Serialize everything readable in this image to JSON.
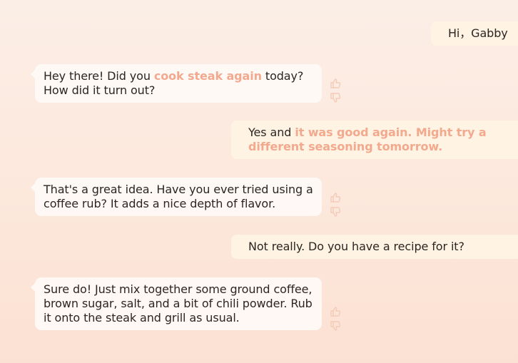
{
  "messages": [
    {
      "role": "user",
      "text": "Hi，Gabby"
    },
    {
      "role": "assistant",
      "parts": [
        "Hey there! Did you ",
        "cook steak again",
        " today? How did it turn out?"
      ]
    },
    {
      "role": "user",
      "parts": [
        "Yes and ",
        "it was good again. Might try a different seasoning tomorrow."
      ]
    },
    {
      "role": "assistant",
      "text": "That's a great idea. Have you ever tried using a coffee rub? It adds a nice depth of flavor."
    },
    {
      "role": "user",
      "text": "Not really. Do you have a recipe for it?"
    },
    {
      "role": "assistant",
      "text": "Sure do! Just mix together some ground coffee, brown sugar, salt, and a bit of chili powder. Rub it onto the steak and grill as usual."
    }
  ],
  "feedback_icons": [
    "thumbs-up-icon",
    "thumbs-down-icon"
  ],
  "colors": {
    "highlight": "#f3a98e",
    "ai_bubble": "#fffaf7",
    "user_bubble": "#fff3e4",
    "icon": "#f3cbb8"
  }
}
